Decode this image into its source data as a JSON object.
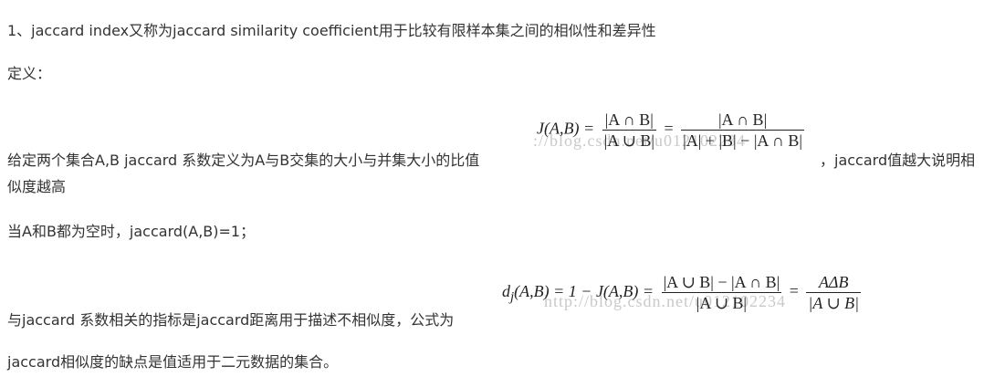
{
  "line1": "1、jaccard index又称为jaccard similarity coefficient用于比较有限样本集之间的相似性和差异性",
  "line2": "定义：",
  "line3_prefix": "给定两个集合A,B jaccard 系数定义为A与B交集的大小与并集大小的比值",
  "line3_suffix": "，jaccard值越大说明相",
  "line3_cont": "似度越高",
  "formula1": {
    "lhs": "J(A,B) =",
    "frac1_num": "|A ∩ B|",
    "frac1_den": "|A ∪ B|",
    "eq": "=",
    "frac2_num": "|A ∩ B|",
    "frac2_den": "|A| + |B| − |A ∩ B|"
  },
  "watermark1": "://blog.csdn.net/u012102234",
  "line4": "当A和B都为空时，jaccard(A,B)=1；",
  "line5": "与jaccard 系数相关的指标是jaccard距离用于描述不相似度，公式为",
  "formula2": {
    "lhs": "d",
    "lhs_sub": "j",
    "lhs_rest": "(A,B) = 1 − J(A,B) =",
    "frac1_num": "|A ∪ B| − |A ∩ B|",
    "frac1_den": "|A ∪ B|",
    "eq": "=",
    "frac2_num": "AΔB",
    "frac2_den": "|A ∪ B|"
  },
  "watermark2": "http://blog.csdn.net/u012102234",
  "line6": "jaccard相似度的缺点是值适用于二元数据的集合。"
}
